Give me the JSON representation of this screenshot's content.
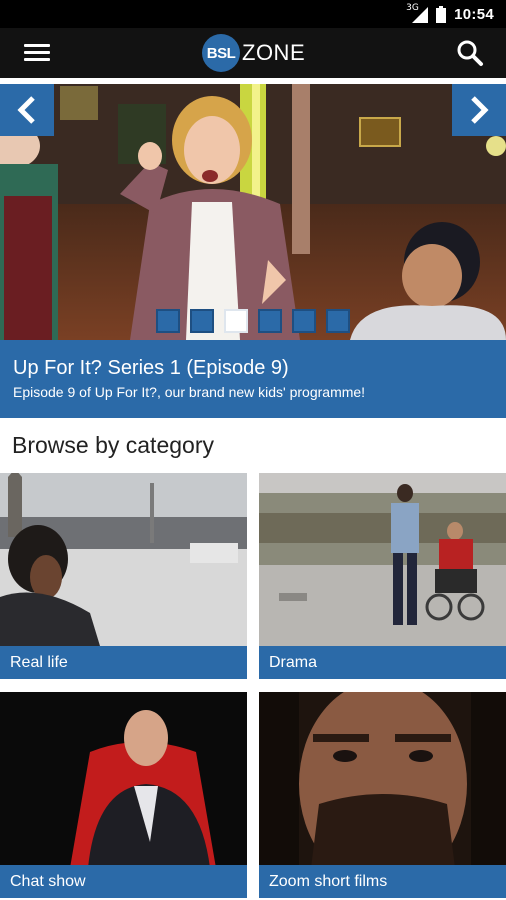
{
  "status_bar": {
    "network_label": "3G",
    "time": "10:54",
    "icons": [
      "signal-icon",
      "battery-icon"
    ]
  },
  "app_bar": {
    "logo_badge": "BSL",
    "logo_text": "ZONE",
    "icons": [
      "menu-icon",
      "search-icon"
    ]
  },
  "carousel": {
    "title": "Up For It? Series 1 (Episode 9)",
    "subtitle": "Episode 9 of Up For It?, our brand new kids' programme!",
    "slide_count": 6,
    "active_slide": 3,
    "icons": [
      "chevron-left-icon",
      "chevron-right-icon"
    ]
  },
  "browse": {
    "heading": "Browse by category",
    "categories": [
      {
        "label": "Real life"
      },
      {
        "label": "Drama"
      },
      {
        "label": "Chat show"
      },
      {
        "label": "Zoom short films"
      }
    ]
  },
  "colors": {
    "accent_blue": "#2b6aa8",
    "app_bar": "#121212",
    "status_bar": "#000000"
  }
}
